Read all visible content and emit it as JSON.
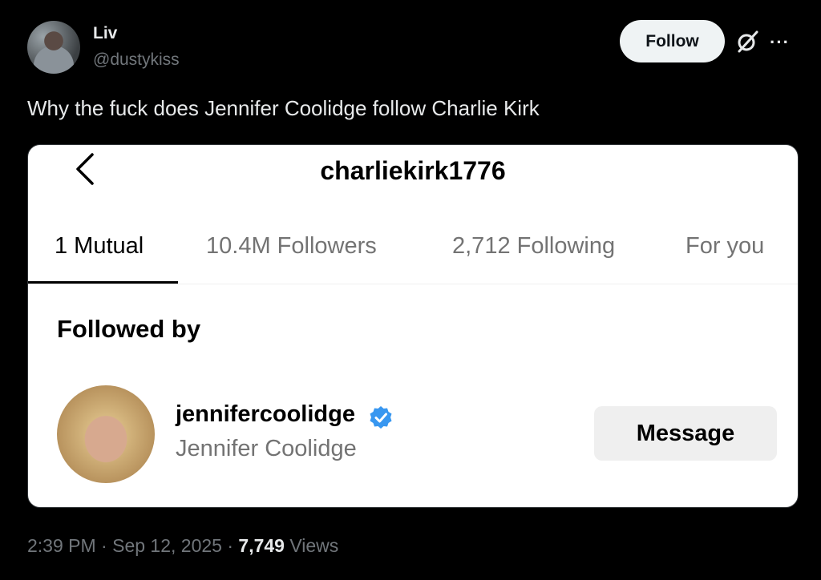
{
  "author": {
    "name": "Liv",
    "handle": "@dustykiss"
  },
  "header": {
    "follow_label": "Follow",
    "more_label": "···"
  },
  "tweet": {
    "text": "Why the fuck does Jennifer Coolidge follow Charlie Kirk"
  },
  "embedded": {
    "title": "charliekirk1776",
    "tabs": [
      {
        "label": "1 Mutual",
        "active": true
      },
      {
        "label": "10.4M Followers",
        "active": false
      },
      {
        "label": "2,712 Following",
        "active": false
      },
      {
        "label": "For you",
        "active": false
      }
    ],
    "section_heading": "Followed by",
    "user": {
      "username": "jennifercoolidge",
      "full_name": "Jennifer Coolidge",
      "verified": true
    },
    "message_label": "Message"
  },
  "meta": {
    "time": "2:39 PM",
    "date": "Sep 12, 2025",
    "views_count": "7,749",
    "views_label": "Views"
  },
  "colors": {
    "background": "#000000",
    "verified": "#3897f0",
    "secondary_text": "#71767b"
  }
}
